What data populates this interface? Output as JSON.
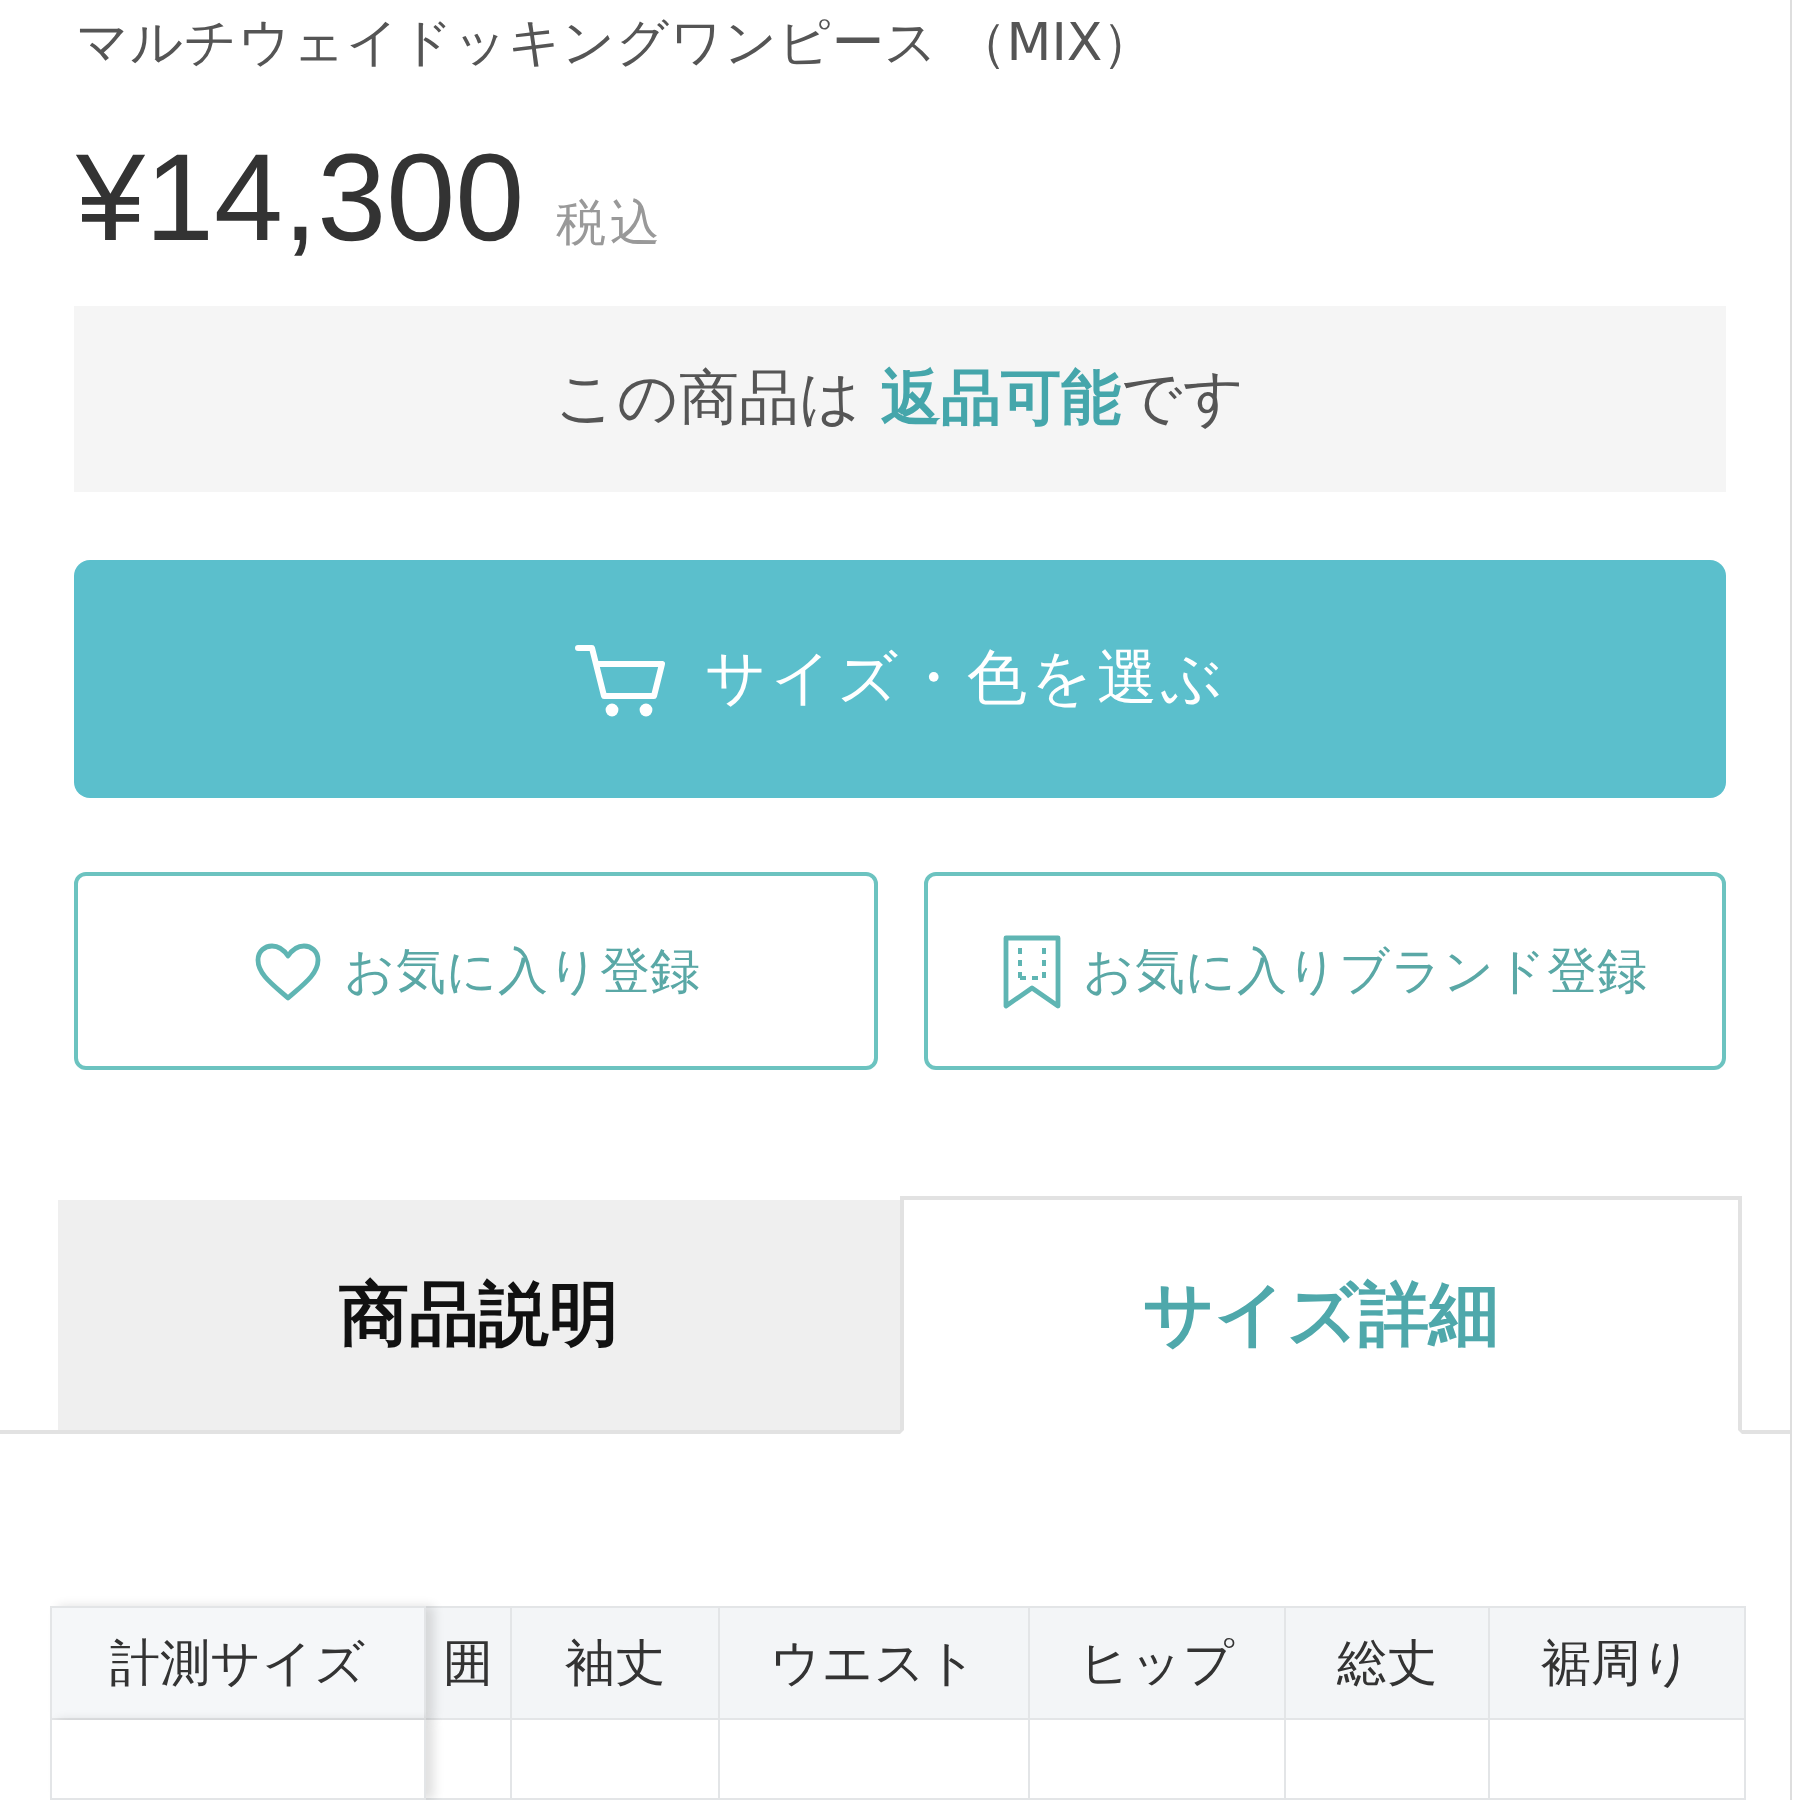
{
  "product": {
    "title": "マルチウェイドッキングワンピース （MIX）",
    "price": "¥14,300",
    "tax_note": "税込"
  },
  "return_notice": {
    "text": "この商品は **返品可能**です"
  },
  "primary_button": {
    "label": "サイズ・色を選ぶ"
  },
  "secondary_buttons": [
    {
      "kind": "favorite",
      "label": "お気に入り登録"
    },
    {
      "kind": "brand",
      "label": "お気に入りブランド登録"
    }
  ],
  "tabs": [
    {
      "label": "商品説明",
      "selected": false
    },
    {
      "label": "サイズ詳細",
      "selected": true
    }
  ],
  "size_table": {
    "columns": [
      "計測サイズ",
      "囲",
      "袖丈",
      "ウエスト",
      "ヒップ",
      "総丈",
      "裾周り"
    ]
  }
}
